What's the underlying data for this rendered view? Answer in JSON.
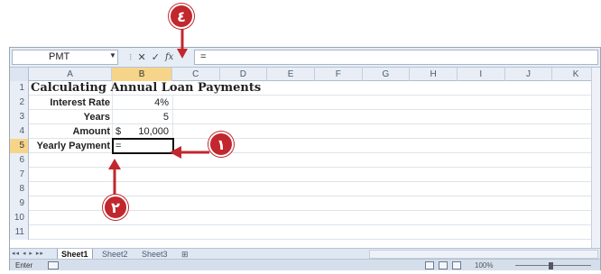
{
  "callouts": {
    "one": "١",
    "two": "٢",
    "four": "٤"
  },
  "formula_bar": {
    "name_box": "PMT",
    "cancel_icon": "✕",
    "enter_icon": "✓",
    "fx_label": "fx",
    "formula": "="
  },
  "columns": [
    "A",
    "B",
    "C",
    "D",
    "E",
    "F",
    "G",
    "H",
    "I",
    "J",
    "K"
  ],
  "rows": [
    "1",
    "2",
    "3",
    "4",
    "5",
    "6",
    "7",
    "8",
    "9",
    "10",
    "11"
  ],
  "sheet": {
    "title": "Calculating Annual Loan Payments",
    "interest_label": "Interest Rate",
    "interest_value": "4%",
    "years_label": "Years",
    "years_value": "5",
    "amount_label": "Amount",
    "amount_currency": "$",
    "amount_value": "10,000",
    "payment_label": "Yearly Payment",
    "payment_value": "="
  },
  "tabs": [
    "Sheet1",
    "Sheet2",
    "Sheet3"
  ],
  "status": {
    "mode": "Enter",
    "zoom": "100%"
  },
  "colors": {
    "annotation": "#c1272d",
    "active_header": "#f6d58a"
  }
}
